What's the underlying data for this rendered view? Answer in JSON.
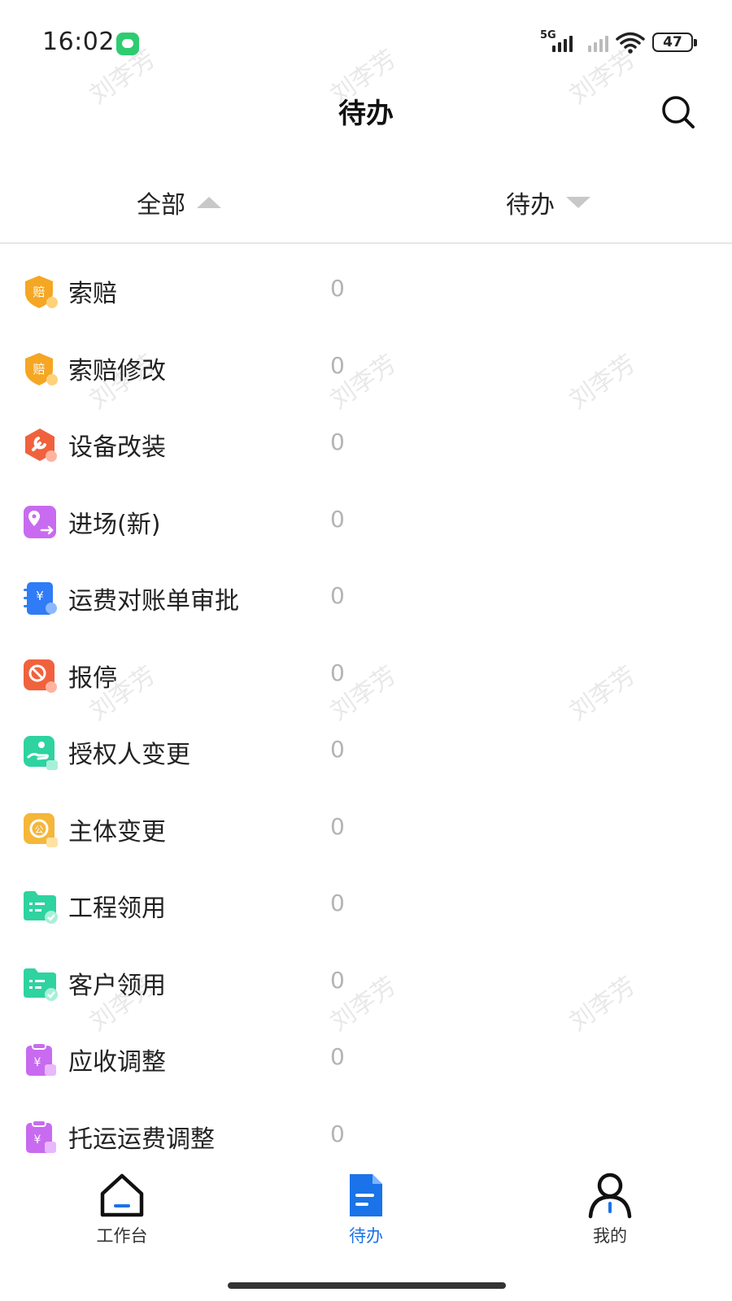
{
  "status_bar": {
    "time": "16:02",
    "network": "5G",
    "battery": "47"
  },
  "header": {
    "title": "待办",
    "search_icon": "search-icon"
  },
  "filters": {
    "scope": {
      "label": "全部",
      "arrow": "up"
    },
    "status": {
      "label": "待办",
      "arrow": "down"
    }
  },
  "list": [
    {
      "label": "索赔",
      "count": "0",
      "icon": "claim-shield-icon",
      "color": "#f5a623"
    },
    {
      "label": "索赔修改",
      "count": "0",
      "icon": "claim-edit-shield-icon",
      "color": "#f5a623"
    },
    {
      "label": "设备改装",
      "count": "0",
      "icon": "wrench-hexagon-icon",
      "color": "#f0623d"
    },
    {
      "label": "进场(新)",
      "count": "0",
      "icon": "location-entry-icon",
      "color": "#c86bf0"
    },
    {
      "label": "运费对账单审批",
      "count": "0",
      "icon": "freight-ledger-icon",
      "color": "#2f7cf6"
    },
    {
      "label": "报停",
      "count": "0",
      "icon": "stop-sign-icon",
      "color": "#f0623d"
    },
    {
      "label": "授权人变更",
      "count": "0",
      "icon": "authorize-hand-icon",
      "color": "#2ed3a0"
    },
    {
      "label": "主体变更",
      "count": "0",
      "icon": "entity-change-icon",
      "color": "#f5b63a"
    },
    {
      "label": "工程领用",
      "count": "0",
      "icon": "folder-check-icon",
      "color": "#2ed3a0"
    },
    {
      "label": "客户领用",
      "count": "0",
      "icon": "folder-check-icon",
      "color": "#2ed3a0"
    },
    {
      "label": "应收调整",
      "count": "0",
      "icon": "clipboard-yuan-icon",
      "color": "#c86bf0"
    },
    {
      "label": "托运运费调整",
      "count": "0",
      "icon": "clipboard-yuan-icon",
      "color": "#c86bf0"
    }
  ],
  "watermark": "刘李芳",
  "bottom_nav": [
    {
      "label": "工作台",
      "icon": "home-icon",
      "active": false
    },
    {
      "label": "待办",
      "icon": "document-icon",
      "active": true
    },
    {
      "label": "我的",
      "icon": "person-icon",
      "active": false
    }
  ],
  "colors": {
    "accent": "#1a73e8",
    "count_gray": "#b4b4b4",
    "divider": "#e6e6e6"
  }
}
